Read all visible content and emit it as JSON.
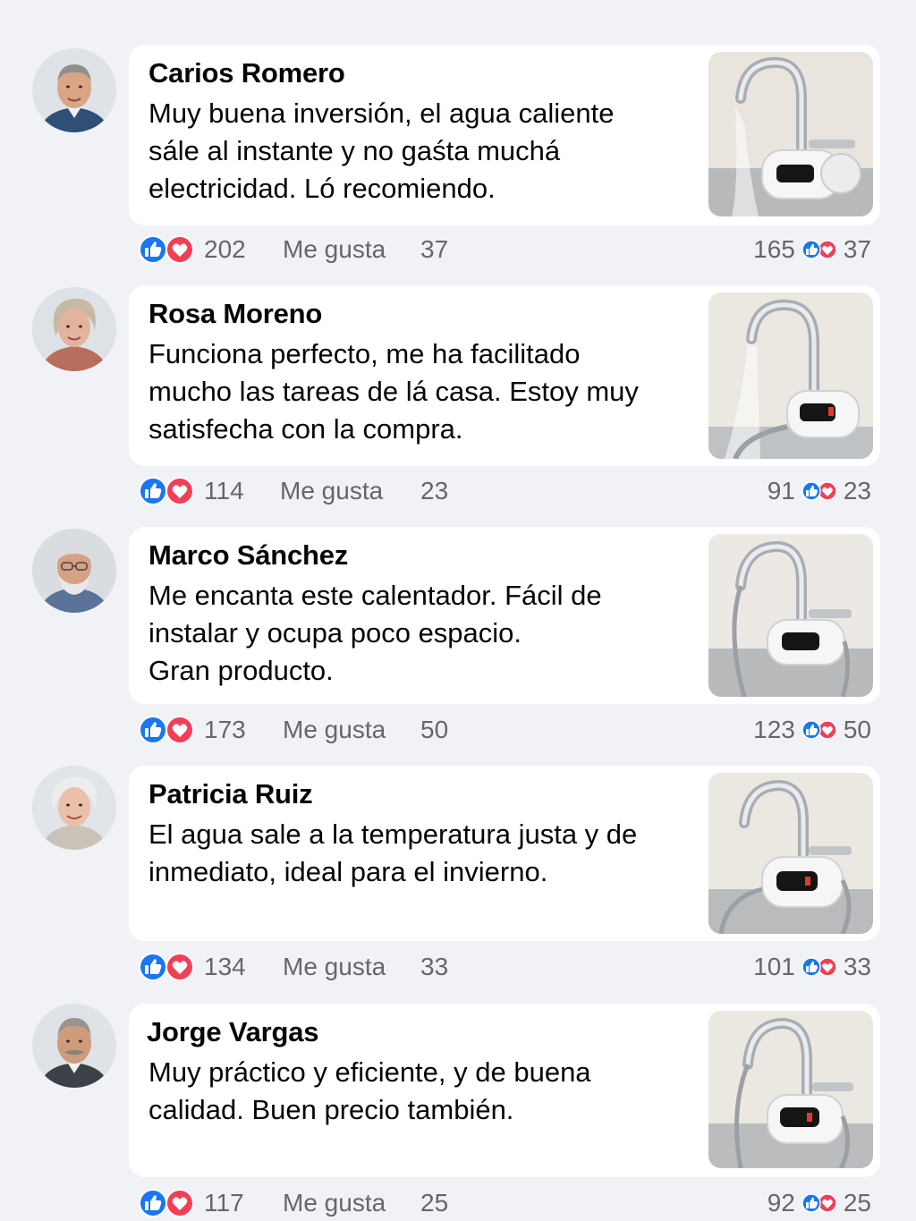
{
  "comments": [
    {
      "author": "Carios Romero",
      "lines": [
        "Muy buena inversión, el agua caliente",
        "sále al instante y no gaśta muchá",
        "electricidad. Ló recomiendo."
      ],
      "reaction_count": "202",
      "like_label": "Me gusta",
      "like_count": "37",
      "right_count": "165",
      "right_count2": "37"
    },
    {
      "author": "Rosa Moreno",
      "lines": [
        "Funciona perfecto, me ha facilitado",
        "mucho las tareas de lá casa. Estoy muy",
        "satisfecha con la compra."
      ],
      "reaction_count": "114",
      "like_label": "Me gusta",
      "like_count": "23",
      "right_count": "91",
      "right_count2": "23"
    },
    {
      "author": "Marco Sánchez",
      "lines": [
        "Me encanta este calentador. Fácil de",
        "instalar y ocupa poco espacio.",
        "Gran producto."
      ],
      "reaction_count": "173",
      "like_label": "Me gusta",
      "like_count": "50",
      "right_count": "123",
      "right_count2": "50"
    },
    {
      "author": "Patricia Ruiz",
      "lines": [
        "El agua sale a la temperatura justa y de",
        "inmediato, ideal para el invierno."
      ],
      "reaction_count": "134",
      "like_label": "Me gusta",
      "like_count": "33",
      "right_count": "101",
      "right_count2": "33"
    },
    {
      "author": "Jorge Vargas",
      "lines": [
        "Muy práctico y eficiente, y de buena",
        "calidad. Buen precio también."
      ],
      "reaction_count": "117",
      "like_label": "Me gusta",
      "like_count": "25",
      "right_count": "92",
      "right_count2": "25"
    }
  ],
  "colors": {
    "like_blue": "#1877f2",
    "love_red": "#f33e58",
    "background": "#f0f2f5",
    "bubble": "#ffffff",
    "meta_text": "#65676b"
  },
  "icons": {
    "like": "thumbs-up-icon",
    "love": "heart-icon"
  }
}
